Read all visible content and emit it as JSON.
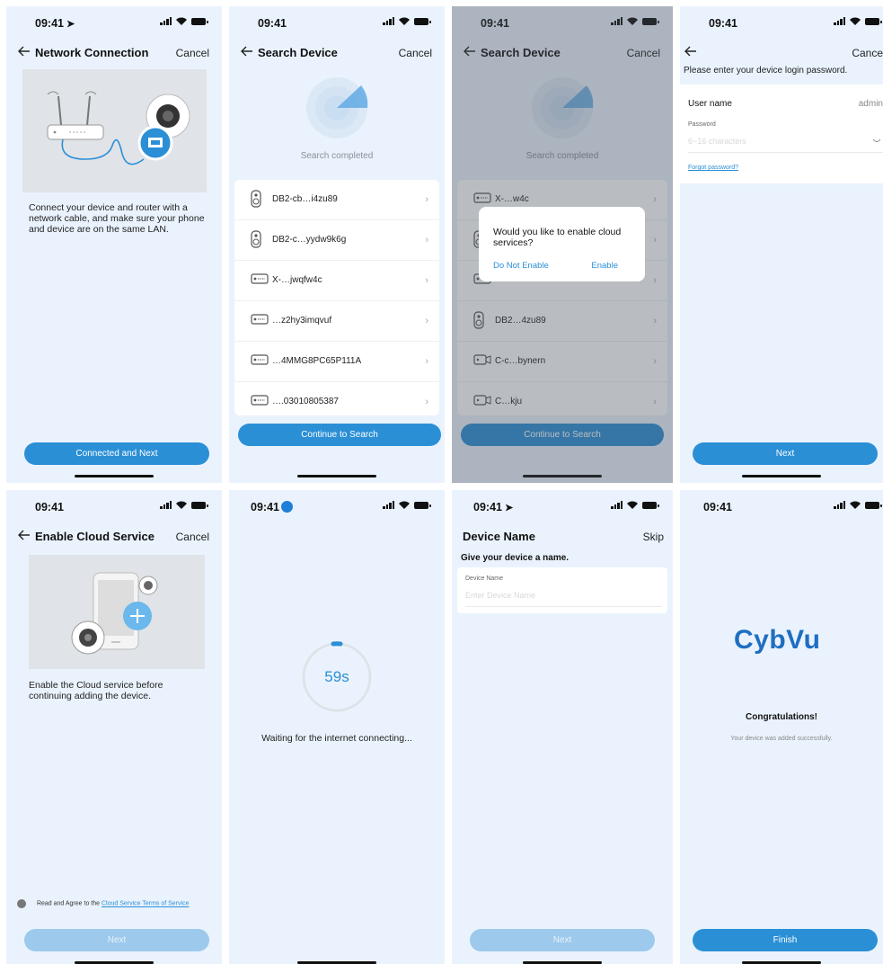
{
  "status": {
    "time": "09:41"
  },
  "s1": {
    "title": "Network Connection",
    "cancel": "Cancel",
    "instruction": "Connect your device and router with a network cable, and make sure your phone and device are on the same LAN.",
    "button": "Connected and Next"
  },
  "s2": {
    "title": "Search Device",
    "cancel": "Cancel",
    "status": "Search completed",
    "devices": [
      {
        "name": "DB2-cb…i4zu89",
        "icon": "doorbell-icon"
      },
      {
        "name": "DB2-c…yydw9k6g",
        "icon": "doorbell-icon"
      },
      {
        "name": "X-…jwqfw4c",
        "icon": "nvr-icon"
      },
      {
        "name": "…z2hy3imqvuf",
        "icon": "nvr-icon"
      },
      {
        "name": "…4MMG8PC65P111A",
        "icon": "nvr-icon"
      },
      {
        "name": "….03010805387",
        "icon": "nvr-icon"
      }
    ],
    "button": "Continue to Search"
  },
  "s3": {
    "title": "Search Device",
    "cancel": "Cancel",
    "status": "Search completed",
    "devices": [
      {
        "name": "X-…w4c",
        "icon": "nvr-icon"
      },
      {
        "name": "",
        "icon": "doorbell-icon"
      },
      {
        "name": "",
        "icon": "nvr-icon"
      },
      {
        "name": "DB2…4zu89",
        "icon": "doorbell-icon"
      },
      {
        "name": "C-c…bynern",
        "icon": "camera-icon"
      },
      {
        "name": "C…kju",
        "icon": "camera-icon"
      }
    ],
    "dialog": {
      "question": "Would you like to enable cloud services?",
      "no": "Do Not Enable",
      "yes": "Enable"
    },
    "button": "Continue to Search"
  },
  "s4": {
    "cancel": "Cance",
    "instruction": "Please enter your device login password.",
    "username_label": "User name",
    "username_value": "admin",
    "password_label": "Password",
    "password_placeholder": "6~16 characters",
    "forgot": "Forgot password?",
    "button": "Next"
  },
  "s5": {
    "title": "Enable Cloud Service",
    "cancel": "Cancel",
    "instruction": "Enable the Cloud service before continuing adding the device.",
    "agree_prefix": "Read and Agree to the ",
    "agree_link": "Cloud Service Terms of Service",
    "button": "Next"
  },
  "s6": {
    "countdown": "59s",
    "message": "Waiting for the internet connecting..."
  },
  "s7": {
    "title": "Device Name",
    "skip": "Skip",
    "instruction": "Give your device a name.",
    "field_label": "Device Name",
    "placeholder": "Enter Device Name",
    "button": "Next"
  },
  "s8": {
    "brand": "CybVu",
    "congrats": "Congratulations!",
    "message": "Your device was added successfully.",
    "button": "Finish"
  },
  "colors": {
    "accent": "#2b8fd6",
    "background": "#eaf3fd",
    "brand": "#1f6ec2"
  }
}
